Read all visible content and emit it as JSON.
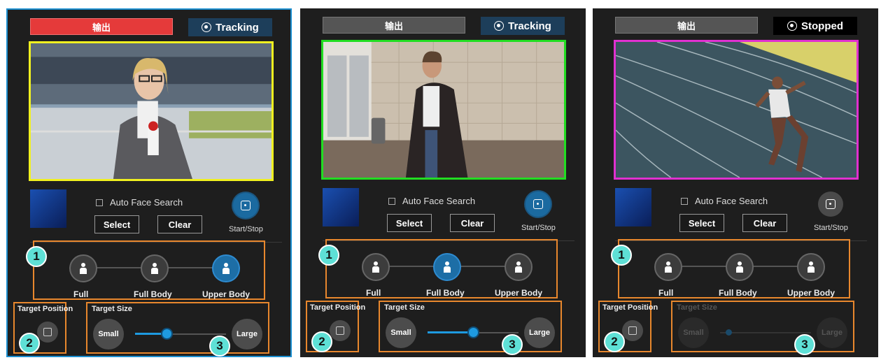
{
  "panels": [
    {
      "output_label": "输出",
      "output_active": true,
      "status": {
        "label": "Tracking",
        "stopped": false
      },
      "border_color": "#f0f020",
      "auto_face_search": "Auto Face Search",
      "select": "Select",
      "clear": "Clear",
      "start_stop": "Start/Stop",
      "start_stop_active": true,
      "framing": {
        "full": "Full",
        "full_body": "Full Body",
        "upper_body": "Upper Body",
        "selected": "upper_body"
      },
      "target_position": "Target Position",
      "target_size": "Target Size",
      "target_size_enabled": true,
      "size_small": "Small",
      "size_large": "Large",
      "size_level": 0.35,
      "badges": [
        "1",
        "2",
        "3"
      ]
    },
    {
      "output_label": "输出",
      "output_active": false,
      "status": {
        "label": "Tracking",
        "stopped": false
      },
      "border_color": "#22dd22",
      "auto_face_search": "Auto Face Search",
      "select": "Select",
      "clear": "Clear",
      "start_stop": "Start/Stop",
      "start_stop_active": true,
      "framing": {
        "full": "Full",
        "full_body": "Full Body",
        "upper_body": "Upper Body",
        "selected": "full_body"
      },
      "target_position": "Target Position",
      "target_size": "Target Size",
      "target_size_enabled": true,
      "size_small": "Small",
      "size_large": "Large",
      "size_level": 0.5,
      "badges": [
        "1",
        "2",
        "3"
      ]
    },
    {
      "output_label": "输出",
      "output_active": false,
      "status": {
        "label": "Stopped",
        "stopped": true
      },
      "border_color": "#e030d0",
      "auto_face_search": "Auto Face Search",
      "select": "Select",
      "clear": "Clear",
      "start_stop": "Start/Stop",
      "start_stop_active": false,
      "framing": {
        "full": "Full",
        "full_body": "Full Body",
        "upper_body": "Upper Body",
        "selected": "none"
      },
      "target_position": "Target Position",
      "target_size": "Target Size",
      "target_size_enabled": false,
      "size_small": "Small",
      "size_large": "Large",
      "size_level": 0.0,
      "badges": [
        "1",
        "2",
        "3"
      ]
    }
  ],
  "colors": {
    "accent_orange": "#e8872d",
    "active_blue": "#1e9ae0",
    "badge_teal": "#5ee0d6",
    "output_red": "#e53a3a"
  },
  "icons": [
    "tracking-icon",
    "start-stop-icon",
    "full-frame-icon",
    "full-body-icon",
    "upper-body-icon",
    "target-position-icon"
  ]
}
